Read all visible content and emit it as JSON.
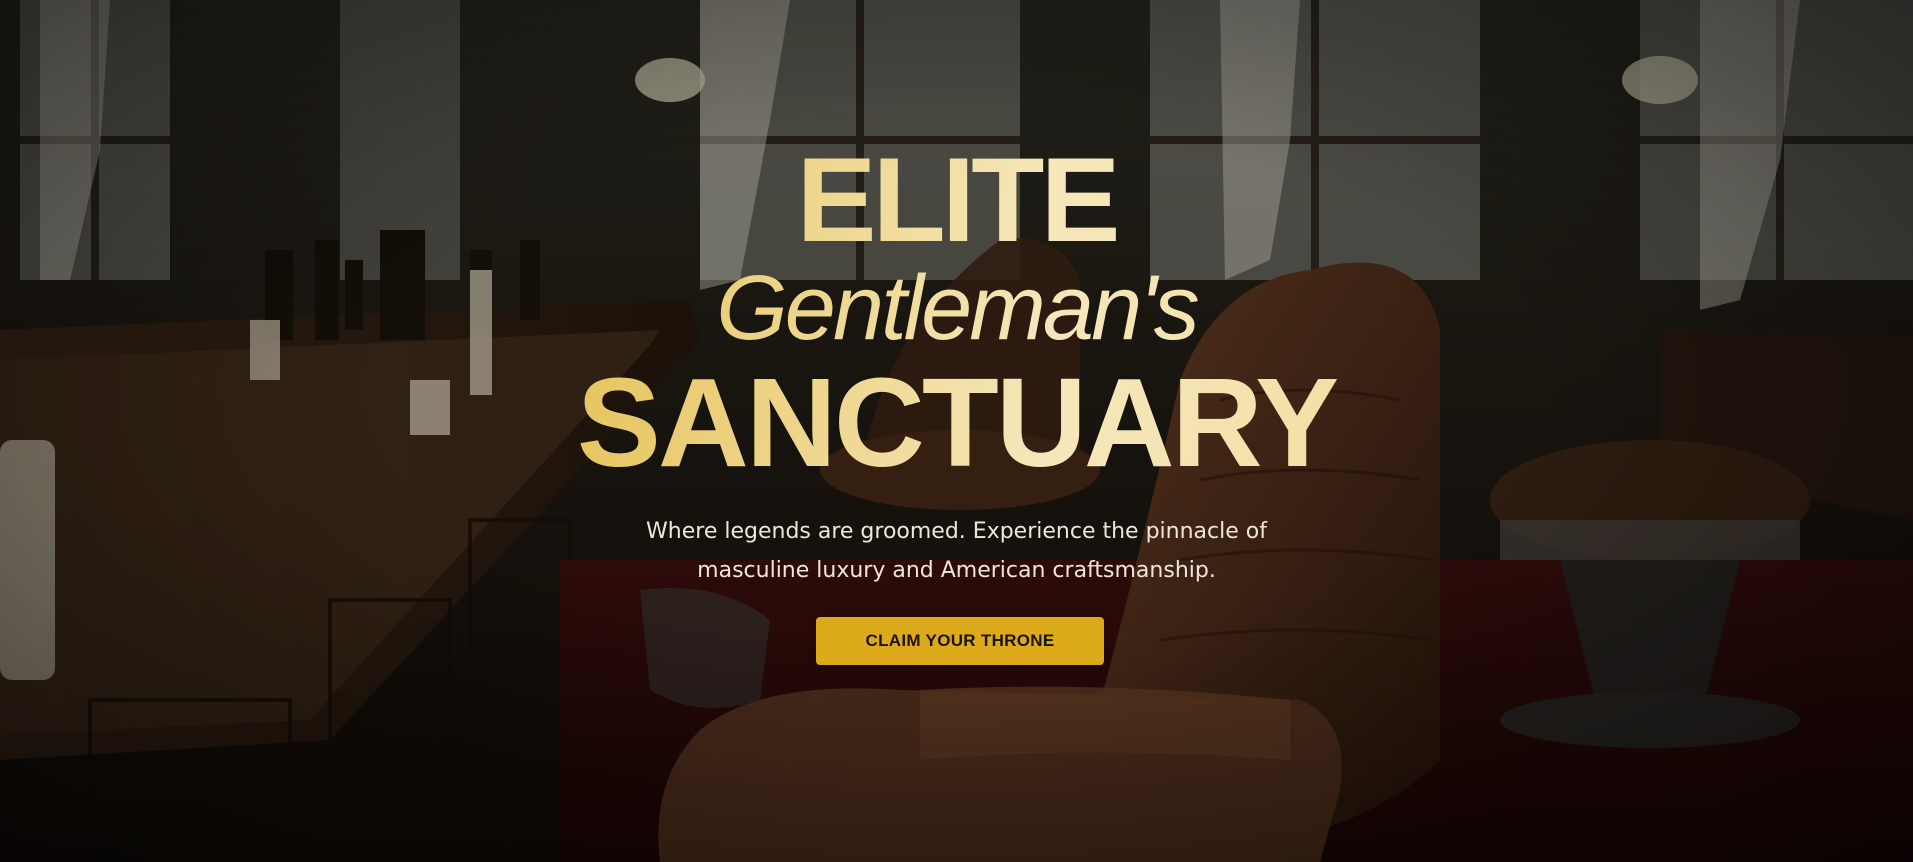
{
  "hero": {
    "headline": {
      "line1": "ELITE",
      "line2": "Gentleman's",
      "line3": "SANCTUARY"
    },
    "subtitle": {
      "line1": "Where legends are groomed. Experience the pinnacle of",
      "line2": "masculine luxury and American craftsmanship."
    },
    "cta_label": "CLAIM YOUR THRONE",
    "background_image": "barbershop-interior",
    "colors": {
      "gold": "#dcaa1a",
      "gold_light": "#f6e7bb",
      "text_light": "#eee6d8",
      "cta_text": "#1b1304"
    }
  }
}
